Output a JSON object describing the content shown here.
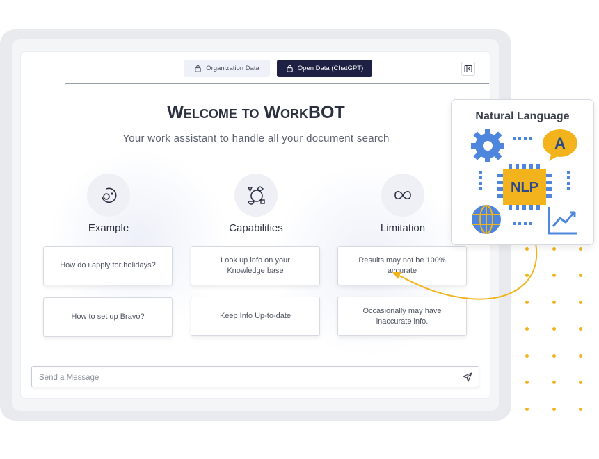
{
  "tabs": {
    "org_label": "Organization Data",
    "open_label": "Open Data (ChatGPT)",
    "org_icon": "lock-icon",
    "open_icon": "lock-icon",
    "active": "Open Data (ChatGPT)"
  },
  "header": {
    "title": "Welcome to WorkBOT",
    "subtitle": "Your work assistant to handle all your document search"
  },
  "columns": [
    {
      "title": "Example",
      "icon": "face-icon",
      "cards": [
        "How do i apply for holidays?",
        "How to set up Bravo?"
      ]
    },
    {
      "title": "Capabilities",
      "icon": "shapes-icon",
      "cards": [
        "Look up info on your Knowledge base",
        "Keep Info Up-to-date"
      ]
    },
    {
      "title": "Limitation",
      "icon": "infinity-icon",
      "cards": [
        "Results may not be 100% accurate",
        "Occasionally may have inaccurate info."
      ]
    }
  ],
  "message": {
    "placeholder": "Send a Message",
    "send_icon": "send-icon"
  },
  "nlp": {
    "title": "Natural Language",
    "chip_label": "NLP",
    "bubble_label": "A"
  },
  "colors": {
    "accent_dark": "#1f2144",
    "gold": "#f2b31c",
    "blue": "#4d86dc"
  }
}
